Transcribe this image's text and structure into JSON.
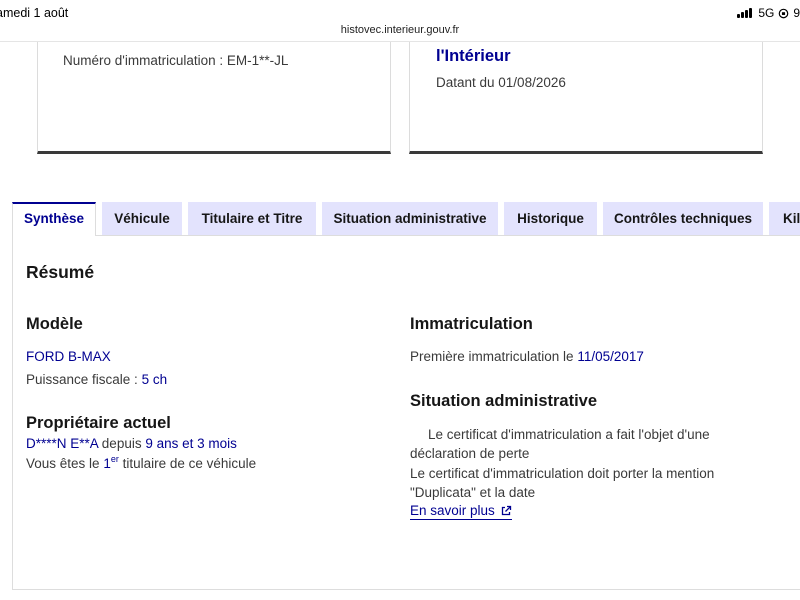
{
  "status_bar": {
    "time": "amedi 1 août",
    "network": "5G",
    "battery": "9("
  },
  "browser": {
    "url": "histovec.interieur.gouv.fr"
  },
  "cards": {
    "left": {
      "plate_label": "Numéro d'immatriculation : EM-1**-JL"
    },
    "right": {
      "org": "l'Intérieur",
      "dated": "Datant du 01/08/2026"
    }
  },
  "tabs": [
    {
      "label": "Synthèse",
      "active": true
    },
    {
      "label": "Véhicule"
    },
    {
      "label": "Titulaire et Titre"
    },
    {
      "label": "Situation administrative"
    },
    {
      "label": "Historique"
    },
    {
      "label": "Contrôles techniques"
    },
    {
      "label": "Kil"
    }
  ],
  "summary": {
    "title": "Résumé",
    "modele": {
      "title": "Modèle",
      "model_name": "FORD B-MAX",
      "fiscal_power_label": "Puissance fiscale : ",
      "fiscal_power_value": "5 ch"
    },
    "owner": {
      "title": "Propriétaire actuel",
      "name": "D****N E**A",
      "since_label": " depuis ",
      "since_value": "9 ans et 3 mois",
      "rank_prefix": "Vous êtes le ",
      "rank_number": "1",
      "rank_suffix": "er",
      "rank_rest": " titulaire de ce véhicule"
    },
    "immatriculation": {
      "title": "Immatriculation",
      "first_label": "Première immatriculation le ",
      "first_date": "11/05/2017"
    },
    "situation": {
      "title": "Situation administrative",
      "line1": "Le certificat d'immatriculation a fait l'objet d'une",
      "line2": "déclaration de perte",
      "line3": "Le certificat d'immatriculation doit porter la mention",
      "line4": "\"Duplicata\" et la date",
      "link_label": "En savoir plus"
    }
  }
}
